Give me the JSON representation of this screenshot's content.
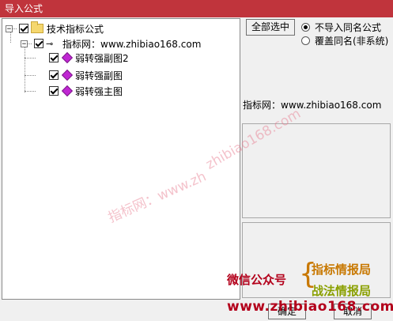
{
  "window": {
    "title": "导入公式"
  },
  "tree": {
    "root": {
      "label": "技术指标公式"
    },
    "group": {
      "label": "指标网：www.zhibiao168.com"
    },
    "items": [
      {
        "label": "弱转强副图2"
      },
      {
        "label": "弱转强副图"
      },
      {
        "label": "弱转强主图"
      }
    ]
  },
  "buttons": {
    "select_all": "全部选中",
    "ok": "确定",
    "cancel": "取消"
  },
  "options": [
    {
      "label": "不导入同名公式",
      "selected": true
    },
    {
      "label": "覆盖同名(非系统)",
      "selected": false
    }
  ],
  "description": "指标网：www.zhibiao168.com",
  "watermark": {
    "text1": "zhibiao168.com",
    "text2": "指标网：www.zh"
  },
  "promo": {
    "wechat": "微信公众号",
    "line1": "指标情报局",
    "line2": "战法情报局",
    "url": "www.zhibiao168.com"
  },
  "colors": {
    "titlebar": "#c0343c",
    "promo_red": "#b3001b",
    "promo_orange": "#c87800",
    "promo_green": "#8aa000",
    "gem": "#c026d3"
  }
}
